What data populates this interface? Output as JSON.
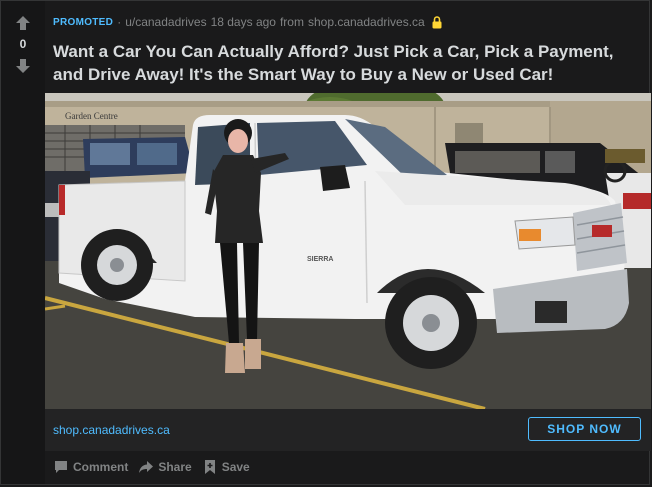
{
  "vote": {
    "score": "0",
    "up_icon": "upvote-arrow-icon",
    "down_icon": "downvote-arrow-icon"
  },
  "meta": {
    "promoted_label": "PROMOTED",
    "separator": "·",
    "user": "u/canadadrives",
    "age": "18 days ago",
    "from_text": "from",
    "source_domain": "shop.canadadrives.ca",
    "lock_icon": "lock-icon"
  },
  "title": "Want a Car You Can Actually Afford? Just Pick a Car, Pick a Payment, and Drive Away! It's the Smart Way to Buy a New or Used Car!",
  "image": {
    "sign_text": "Garden Centre",
    "badge_text": "SIERRA"
  },
  "cta": {
    "domain": "shop.canadadrives.ca",
    "button_label": "SHOP NOW"
  },
  "actions": [
    {
      "label": "Comment",
      "icon": "comment-icon"
    },
    {
      "label": "Share",
      "icon": "share-icon"
    },
    {
      "label": "Save",
      "icon": "save-icon"
    }
  ],
  "colors": {
    "background": "#1a1a1b",
    "vote_column": "#161617",
    "accent_blue": "#4fbcff",
    "lock_yellow": "#ffd635",
    "muted_text": "#818384",
    "title_text": "#d7dadc"
  }
}
